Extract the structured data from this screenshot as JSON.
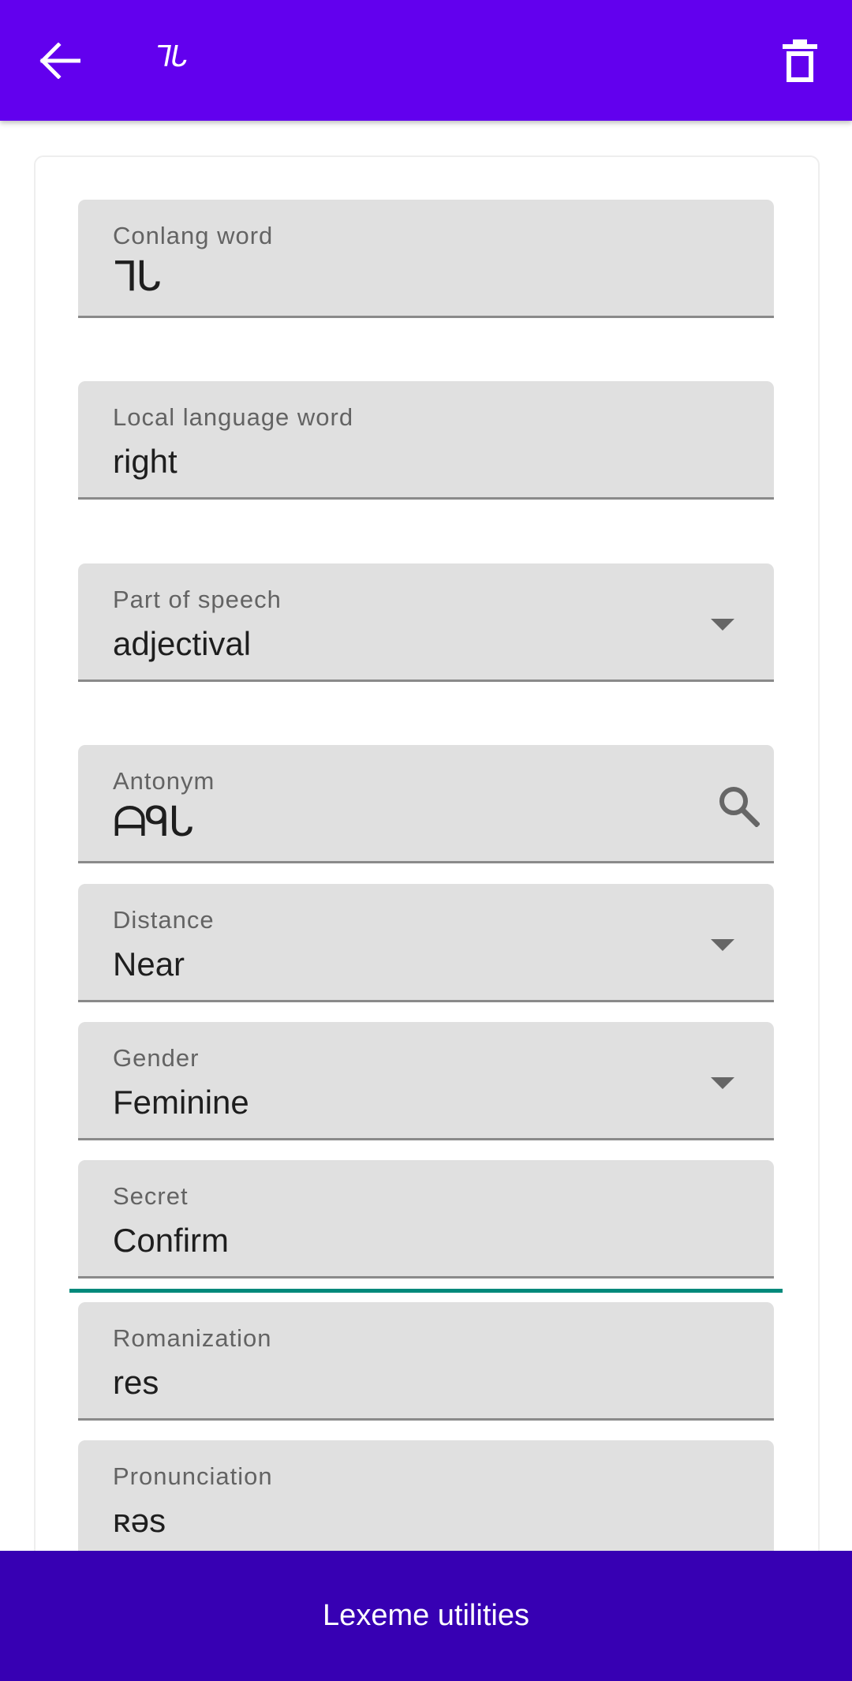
{
  "header": {
    "title": "ᒣᒐ",
    "back_icon": "arrow-back-icon",
    "delete_icon": "trash-icon"
  },
  "form": {
    "conlang_word": {
      "label": "Conlang word",
      "value": "ᒣᒐ"
    },
    "local_word": {
      "label": "Local language word",
      "value": "right"
    },
    "part_of_speech": {
      "label": "Part of speech",
      "value": "adjectival"
    },
    "antonym": {
      "label": "Antonym",
      "value": "ᗩᑫᒐ"
    },
    "distance": {
      "label": "Distance",
      "value": "Near"
    },
    "gender": {
      "label": "Gender",
      "value": "Feminine"
    },
    "secret": {
      "label": "Secret",
      "value": "Confirm"
    },
    "romanization": {
      "label": "Romanization",
      "value": "res"
    },
    "pronunciation": {
      "label": "Pronunciation",
      "value": "ʀəs"
    }
  },
  "bottom_bar": {
    "label": "Lexeme utilities"
  },
  "colors": {
    "app_bar": "#6200ee",
    "bottom_bar": "#3700b3",
    "focus_accent": "#00897b",
    "field_bg": "#e0e0e0"
  }
}
